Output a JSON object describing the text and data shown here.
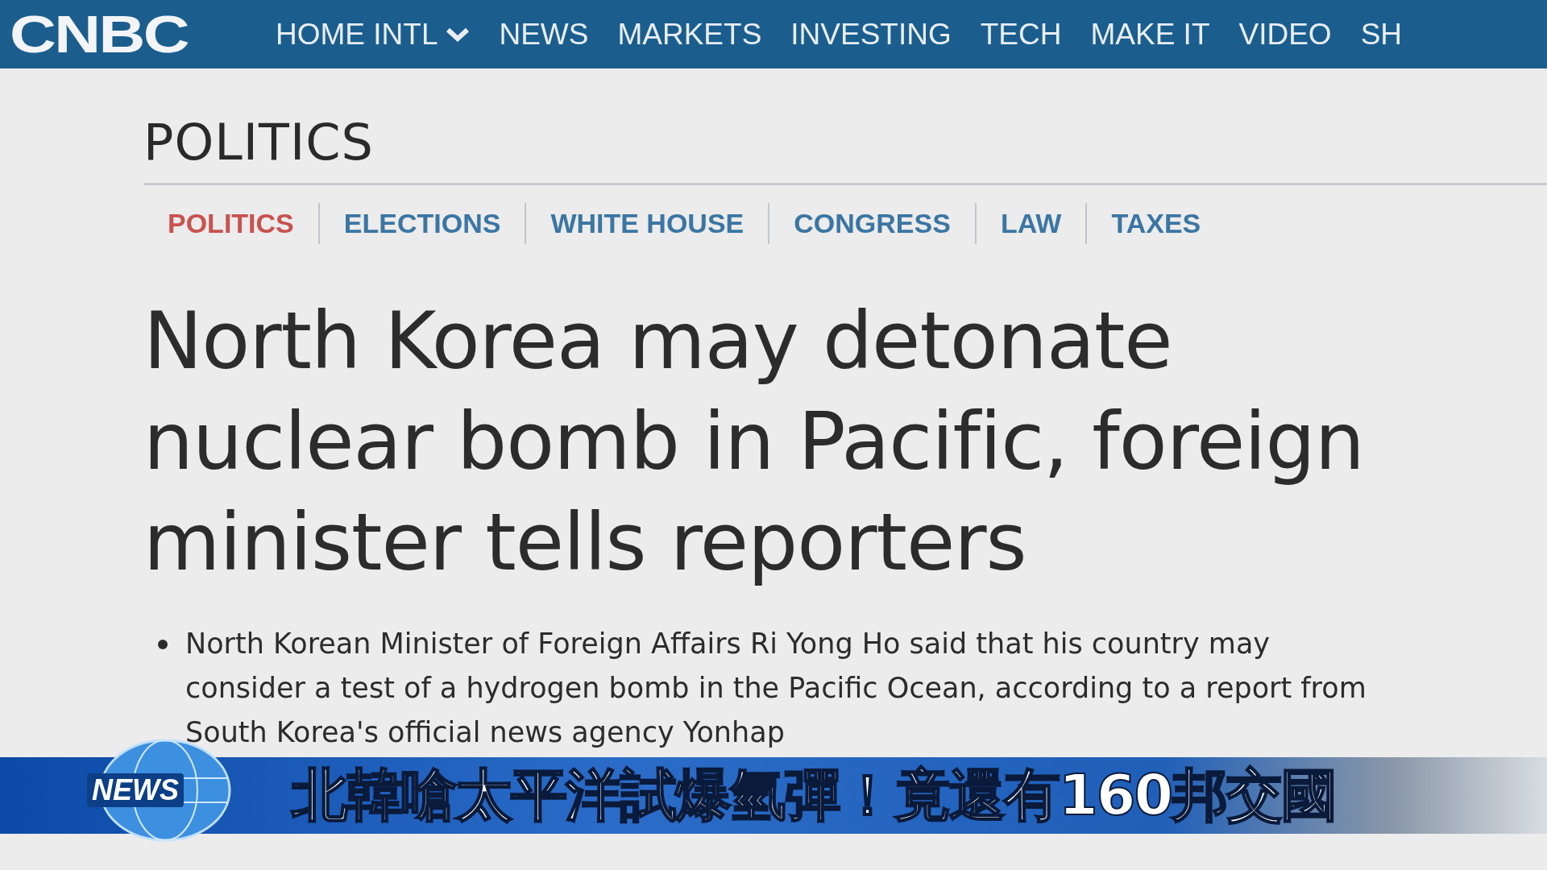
{
  "header": {
    "logo": "CNBC",
    "nav": [
      {
        "label": "HOME INTL",
        "dropdown": true
      },
      {
        "label": "NEWS",
        "dropdown": false
      },
      {
        "label": "MARKETS",
        "dropdown": false
      },
      {
        "label": "INVESTING",
        "dropdown": false
      },
      {
        "label": "TECH",
        "dropdown": false
      },
      {
        "label": "MAKE IT",
        "dropdown": false
      },
      {
        "label": "VIDEO",
        "dropdown": false
      },
      {
        "label": "SH",
        "dropdown": false
      }
    ]
  },
  "section": {
    "title": "POLITICS",
    "tabs": [
      {
        "label": "POLITICS",
        "selected": true
      },
      {
        "label": "ELECTIONS",
        "selected": false
      },
      {
        "label": "WHITE HOUSE",
        "selected": false
      },
      {
        "label": "CONGRESS",
        "selected": false
      },
      {
        "label": "LAW",
        "selected": false
      },
      {
        "label": "TAXES",
        "selected": false
      }
    ]
  },
  "article": {
    "headline": "North Korea may detonate nuclear bomb in Pacific, foreign minister tells reporters",
    "bullets": [
      "North Korean Minister of Foreign Affairs Ri Yong Ho said that his country may consider a test of a hydrogen bomb in the Pacific Ocean, according to a report from South Korea's official news agency Yonhap"
    ]
  },
  "caption_bar": {
    "badge": "NEWS",
    "text": "北韓嗆太平洋試爆氫彈！竟還有160邦交國"
  }
}
